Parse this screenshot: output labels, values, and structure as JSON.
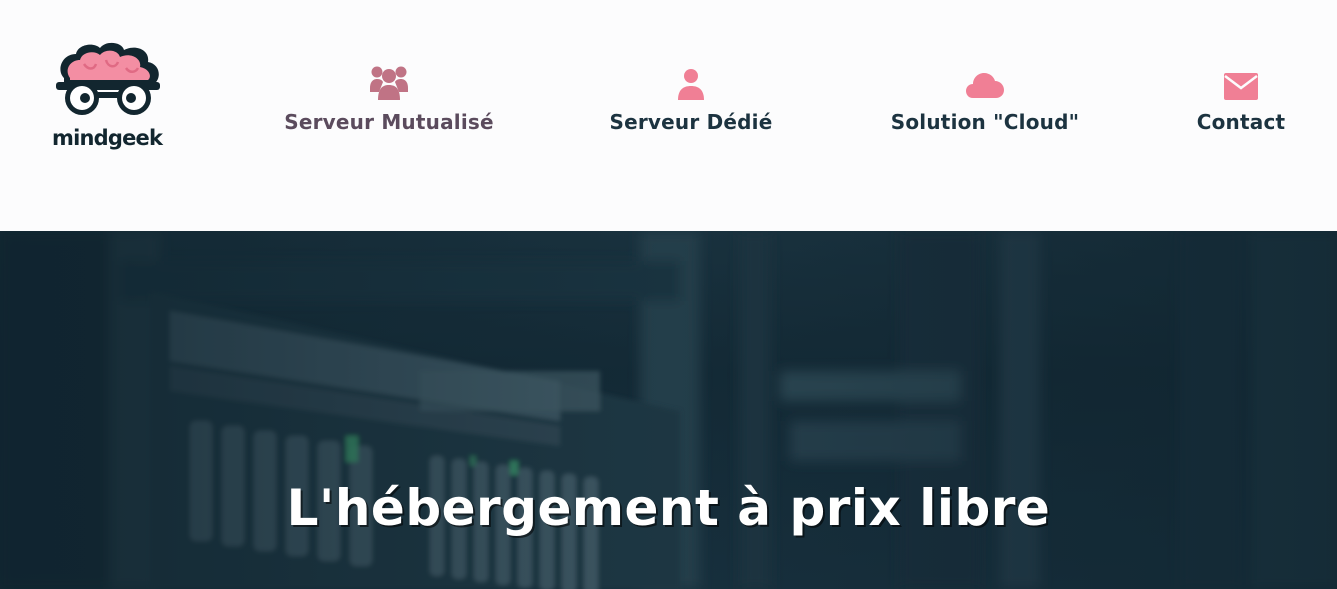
{
  "brand": {
    "logo_text": "mindgeek",
    "logo_icon": "brain-with-glasses-icon"
  },
  "nav": {
    "items": [
      {
        "label": "Serveur Mutualisé",
        "icon": "group-icon",
        "active": true
      },
      {
        "label": "Serveur Dédié",
        "icon": "user-icon",
        "active": false
      },
      {
        "label": "Solution \"Cloud\"",
        "icon": "cloud-icon",
        "active": false
      },
      {
        "label": "Contact",
        "icon": "envelope-icon",
        "active": false
      }
    ]
  },
  "hero": {
    "title": "L'hébergement à prix libre",
    "background": "server-rack-photo"
  },
  "colors": {
    "accent_pink": "#f07f95",
    "active_pink": "#c07385",
    "text_dark": "#1c3340",
    "active_text": "#5b4b5d",
    "hero_bg": "#1a3442",
    "header_bg": "#fcfcfd"
  }
}
